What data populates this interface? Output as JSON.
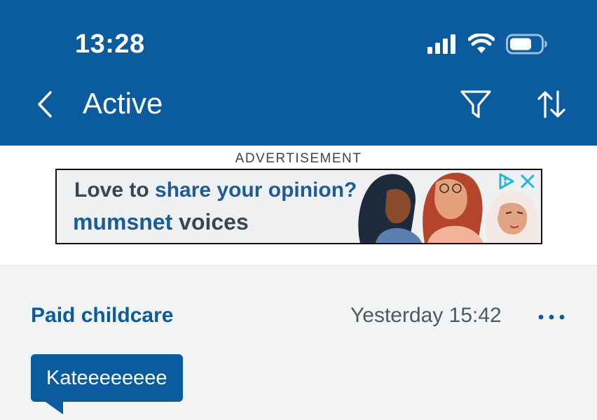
{
  "status_bar": {
    "time": "13:28"
  },
  "nav": {
    "title": "Active"
  },
  "ad": {
    "label": "ADVERTISEMENT",
    "line1_prefix": "Love to ",
    "line1_highlight": "share your opinion?",
    "line2_brand": "mumsnet",
    "line2_rest": " voices"
  },
  "thread": {
    "title": "Paid childcare",
    "time": "Yesterday 15:42",
    "author": "Kateeeeeeee"
  },
  "colors": {
    "header_bg": "#0a5c9e",
    "accent": "#0a5c9e",
    "page_bg": "#f2f3f3"
  }
}
